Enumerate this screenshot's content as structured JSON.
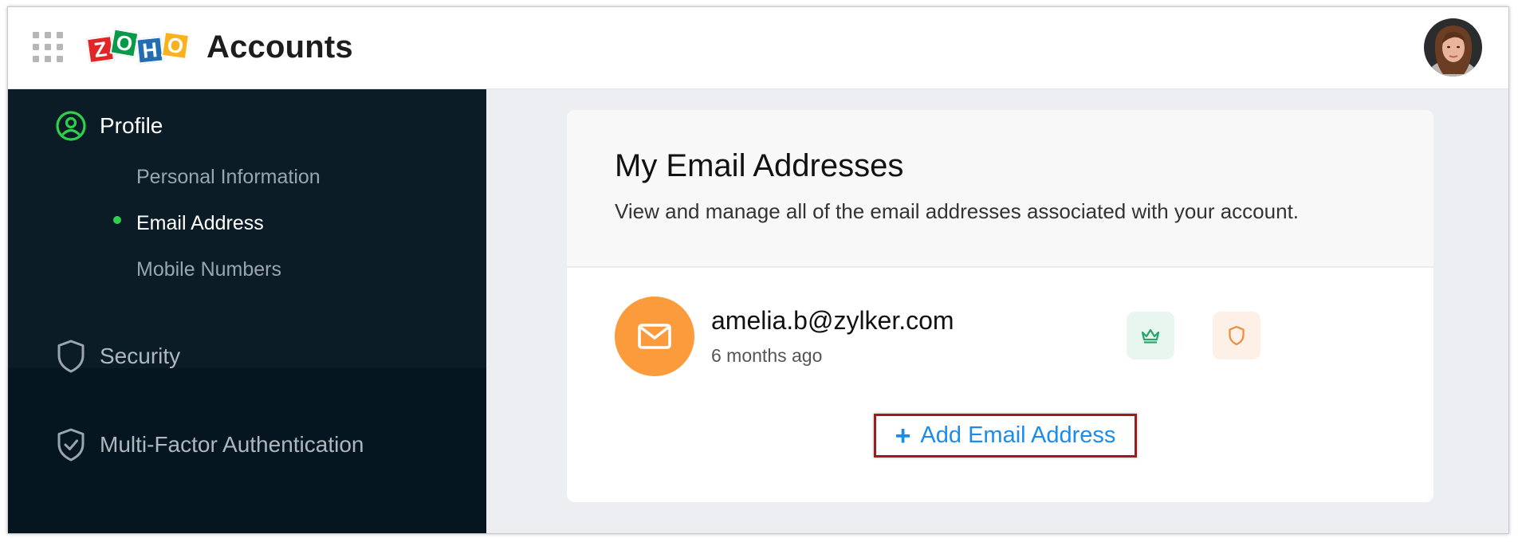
{
  "header": {
    "logo_letters": [
      "Z",
      "O",
      "H",
      "O"
    ],
    "logo_colors": [
      "#e42527",
      "#089949",
      "#226db4",
      "#f9b21d"
    ],
    "app_title": "Accounts"
  },
  "sidebar": {
    "profile": {
      "label": "Profile",
      "icon": "user-circle-icon",
      "active_color": "#2ed14b",
      "items": [
        {
          "label": "Personal Information",
          "active": false
        },
        {
          "label": "Email Address",
          "active": true
        },
        {
          "label": "Mobile Numbers",
          "active": false
        }
      ]
    },
    "security": {
      "label": "Security",
      "icon": "shield-icon"
    },
    "mfa": {
      "label": "Multi-Factor Authentication",
      "icon": "shield-check-icon"
    }
  },
  "card": {
    "title": "My Email Addresses",
    "description": "View and manage all of the email addresses associated with your account.",
    "emails": [
      {
        "address": "amelia.b@zylker.com",
        "added": "6 months ago",
        "icon": "mail-icon",
        "badges": [
          "crown-icon",
          "shield-icon"
        ]
      }
    ],
    "add_button": {
      "plus": "+",
      "label": "Add Email Address"
    }
  },
  "colors": {
    "sidebar_bg": "#061620",
    "sidebar_active_block": "#0b1c27",
    "accent_green": "#2ed14b",
    "link_blue": "#1a8ced",
    "email_orange": "#fb9b3b"
  }
}
